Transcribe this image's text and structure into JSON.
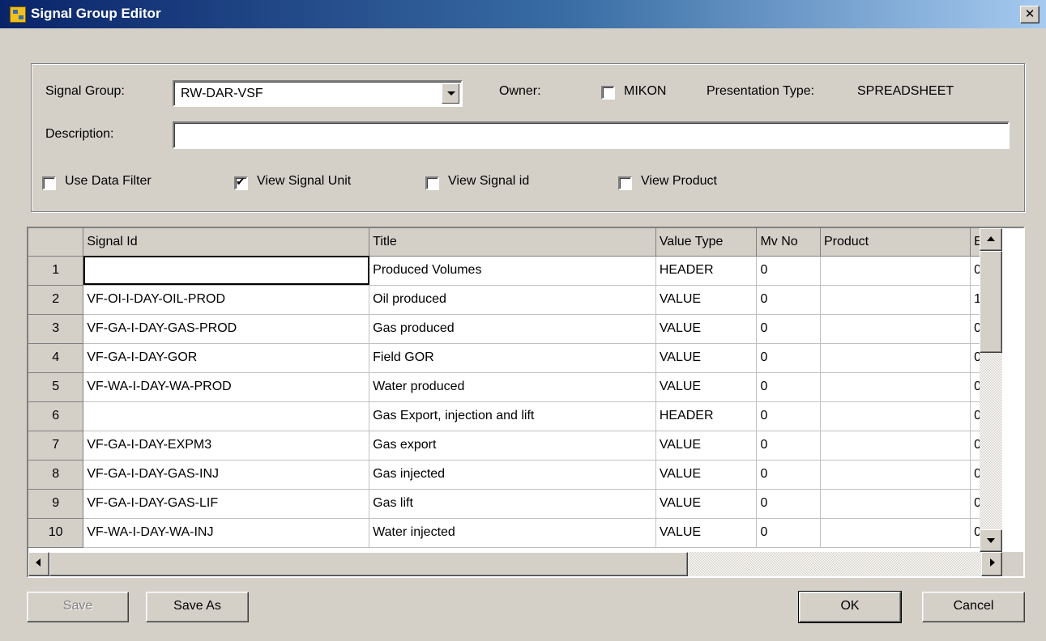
{
  "window": {
    "title": "Signal Group Editor",
    "close_glyph": "✕"
  },
  "form": {
    "signal_group_label": "Signal Group:",
    "signal_group_value": "RW-DAR-VSF",
    "owner_label": "Owner:",
    "owner_checkbox_label": "MIKON",
    "owner_checked": false,
    "presentation_type_label": "Presentation Type:",
    "presentation_type_value": "SPREADSHEET",
    "description_label": "Description:",
    "description_value": "",
    "use_data_filter_label": "Use Data Filter",
    "use_data_filter_checked": false,
    "view_signal_unit_label": "View Signal Unit",
    "view_signal_unit_checked": true,
    "view_signal_id_label": "View Signal id",
    "view_signal_id_checked": false,
    "view_product_label": "View Product",
    "view_product_checked": false
  },
  "grid": {
    "columns": [
      "",
      "Signal Id",
      "Title",
      "Value Type",
      "Mv No",
      "Product",
      "E"
    ],
    "rows": [
      [
        "1",
        "",
        "Produced Volumes",
        "HEADER",
        "0",
        "",
        "0"
      ],
      [
        "2",
        "VF-OI-I-DAY-OIL-PROD",
        "Oil produced",
        "VALUE",
        "0",
        "",
        "1"
      ],
      [
        "3",
        "VF-GA-I-DAY-GAS-PROD",
        "Gas produced",
        "VALUE",
        "0",
        "",
        "0"
      ],
      [
        "4",
        "VF-GA-I-DAY-GOR",
        "Field GOR",
        "VALUE",
        "0",
        "",
        "0"
      ],
      [
        "5",
        "VF-WA-I-DAY-WA-PROD",
        "Water produced",
        "VALUE",
        "0",
        "",
        "0"
      ],
      [
        "6",
        "",
        "Gas Export, injection and lift",
        "HEADER",
        "0",
        "",
        "0"
      ],
      [
        "7",
        "VF-GA-I-DAY-EXPM3",
        "Gas export",
        "VALUE",
        "0",
        "",
        "0"
      ],
      [
        "8",
        "VF-GA-I-DAY-GAS-INJ",
        "Gas injected",
        "VALUE",
        "0",
        "",
        "0"
      ],
      [
        "9",
        "VF-GA-I-DAY-GAS-LIF",
        "Gas lift",
        "VALUE",
        "0",
        "",
        "0"
      ],
      [
        "10",
        "VF-WA-I-DAY-WA-INJ",
        "Water injected",
        "VALUE",
        "0",
        "",
        "0"
      ]
    ]
  },
  "buttons": {
    "save": "Save",
    "save_as": "Save As",
    "ok": "OK",
    "cancel": "Cancel"
  }
}
